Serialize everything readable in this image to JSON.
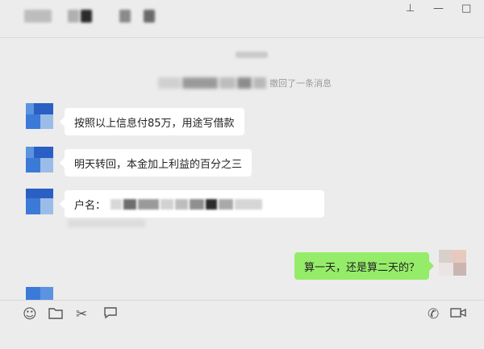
{
  "window": {
    "controls": {
      "pin": "⊥",
      "minimize": "—",
      "maximize": "□"
    }
  },
  "chat": {
    "system_notice": "撤回了一条消息",
    "messages": [
      {
        "side": "left",
        "text": "按照以上信息付85万，用途写借款"
      },
      {
        "side": "left",
        "text": "明天转回，本金加上利益的百分之三"
      },
      {
        "side": "left",
        "label": "户名："
      },
      {
        "side": "right",
        "text": "算一天，还是算二天的？"
      }
    ]
  },
  "toolbar": {
    "icons": [
      "emoji-icon",
      "folder-icon",
      "scissors-icon",
      "chat-bubble-icon",
      "phone-icon",
      "video-icon"
    ]
  },
  "colors": {
    "background": "#ececec",
    "incoming_bubble": "#ffffff",
    "outgoing_bubble": "#95ec69",
    "avatar_blue": "#2f6fd6"
  }
}
